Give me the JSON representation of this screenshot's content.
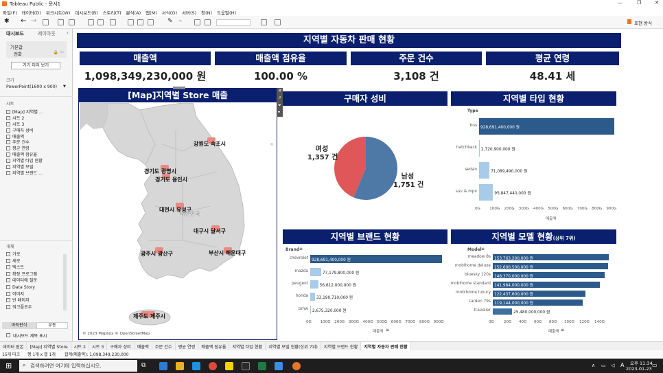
{
  "window": {
    "title": "Tableau Public - 문서1"
  },
  "menu": [
    "파일(F)",
    "데이터(D)",
    "워크시트(W)",
    "대시보드(B)",
    "스토리(T)",
    "분석(A)",
    "맵(M)",
    "서식(O)",
    "서버(S)",
    "창(N)",
    "도움말(H)"
  ],
  "toolbar": {
    "present_label": "표현 방식"
  },
  "left_pane": {
    "tab_dashboard": "대시보드",
    "tab_layout": "레이아웃",
    "device_label": "기본값",
    "device_value": "전화",
    "preview_button": "기기 미리 보기",
    "size_label": "크기",
    "size_value": "PowerPoint(1600 x 900)",
    "sheets_label": "시트",
    "sheets": [
      "[Map] 지역별 ...",
      "시트 2",
      "시트 3",
      "구매자 성비",
      "매출액",
      "주문 건수",
      "평균 연령",
      "매출액 점유율",
      "지역별 타입 현황",
      "지역별 모델",
      "지역별 브랜드 ..."
    ],
    "objects_label": "개체",
    "objects": [
      "가로",
      "세로",
      "텍스트",
      "확장 프로그램",
      "데이터에 질문",
      "Data Story",
      "이미지",
      "빈 페이지",
      "워크플로우"
    ],
    "tiled_button": "바둑판식",
    "floating_button": "부동",
    "show_title": "대시보드 제목 표시"
  },
  "dashboard": {
    "title": "지역별 자동차 판매 현황",
    "kpis": [
      {
        "label": "매출액",
        "value": "1,098,349,230,000 원"
      },
      {
        "label": "매출액 점유율",
        "value": "100.00 %"
      },
      {
        "label": "주문 건수",
        "value": "3,108 건"
      },
      {
        "label": "평균 연령",
        "value": "48.41 세"
      }
    ],
    "map": {
      "title": "[Map]지역별 Store 매출",
      "credit": "© 2023 Mapbox © OpenStreetMap",
      "watermark": "대한민국",
      "labels": [
        "강원도 속초시",
        "경기도 광명시",
        "경기도 용인시",
        "대전시 유성구",
        "대구시 달서구",
        "광주시 광산구",
        "부산시 해운대구",
        "제주도 제주시"
      ]
    },
    "gender": {
      "title": "구매자 성비",
      "female_label": "여성",
      "female_value": "1,357 건",
      "male_label": "남성",
      "male_value": "1,751 건",
      "colors": {
        "female": "#e05759",
        "male": "#4e79a7"
      }
    },
    "type_chart": {
      "title": "지역별 타입 현황",
      "field": "Type",
      "axis_title": "매출액"
    },
    "brand_chart": {
      "title": "지역별 브랜드 현황",
      "field": "Brand",
      "axis_title": "매출액"
    },
    "model_chart": {
      "title": "지역별 모델 현황",
      "title_suffix": "(상위 7위)",
      "field": "Model",
      "axis_title": "매출액"
    }
  },
  "chart_data": [
    {
      "type": "pie",
      "categories": [
        "여성",
        "남성"
      ],
      "values": [
        1357,
        1751
      ]
    },
    {
      "type": "bar",
      "orientation": "horizontal",
      "categories": [
        "bus",
        "hatchback",
        "sedan",
        "suv & mpv"
      ],
      "values": [
        928691400000,
        2720900000,
        71089490000,
        95847440000
      ],
      "data_labels": [
        "928,691,400,000 원",
        "2,720,900,000 원",
        "71,089,490,000 원",
        "95,847,440,000 원"
      ],
      "ticks": [
        "0G",
        "100G",
        "200G",
        "300G",
        "400G",
        "500G",
        "600G",
        "700G",
        "800G",
        "900G"
      ],
      "xlim": [
        0,
        950000000000
      ],
      "xlabel": "매출액"
    },
    {
      "type": "bar",
      "orientation": "horizontal",
      "categories": [
        "chevrolet",
        "mazda",
        "peugeot",
        "honda",
        "bmw"
      ],
      "values": [
        928691400000,
        77179800000,
        56612000000,
        33190710000,
        2675320000
      ],
      "data_labels": [
        "928,691,400,000 원",
        "77,179,800,000 원",
        "56,612,000,000 원",
        "33,190,710,000 원",
        "2,675,320,000 원"
      ],
      "ticks": [
        "0G",
        "100G",
        "200G",
        "300G",
        "400G",
        "500G",
        "600G",
        "700G",
        "800G",
        "900G"
      ],
      "xlim": [
        0,
        950000000000
      ],
      "xlabel": "매출액"
    },
    {
      "type": "bar",
      "orientation": "horizontal",
      "categories": [
        "meadow 8s",
        "mobihome deluxe",
        "bluesky 120s",
        "mobihome standard",
        "mobihome luxury",
        "carden 79s",
        "traveller"
      ],
      "values": [
        153763200000,
        152600500000,
        148370000000,
        141984000000,
        122437600000,
        119144000000,
        25480000000
      ],
      "data_labels": [
        "153,763,200,000 원",
        "152,600,500,000 원",
        "148,370,000,000 원",
        "141,984,000,000 원",
        "122,437,600,000 원",
        "119,144,000,000 원",
        "25,480,000,000 원"
      ],
      "ticks": [
        "0G",
        "20G",
        "40G",
        "60G",
        "80G",
        "100G",
        "120G",
        "140G"
      ],
      "xlim": [
        0,
        160000000000
      ],
      "xlabel": "매출액"
    }
  ],
  "sheet_tabs": [
    "데이터 원본",
    "[Map] 지역별 Store",
    "시트 2",
    "시트 3",
    "구매자 성비",
    "매출액",
    "주문 건수",
    "평균 연령",
    "매출액 점유율",
    "지역별 타입 현황",
    "지역별 모델 현황(상위 7위)",
    "지역별 브랜드 현황",
    "지역별 자동차 판매 현황"
  ],
  "status": {
    "marks": "15개 마크",
    "rows": "행 1개 x 열 1개",
    "sum": "합계(매출액): 1,098,349,230,000"
  },
  "taskbar": {
    "search_placeholder": "검색하려면 여기에 입력하십시오.",
    "time": "오후 11:34",
    "date": "2023-01-23",
    "lang": "A"
  }
}
